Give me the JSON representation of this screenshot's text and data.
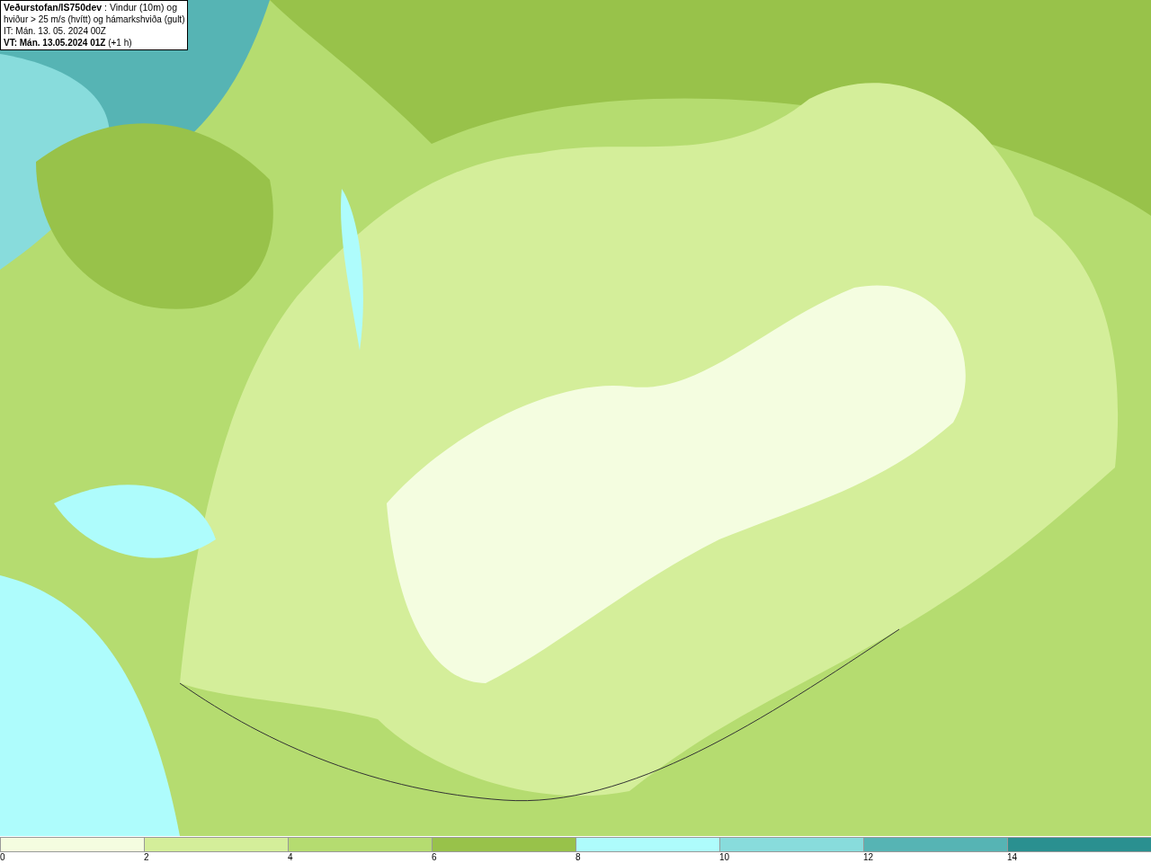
{
  "map": {
    "title_lines": [
      "**Veðurstofan/IS750dev** : Vindur (10m) og",
      "hviður > 25 m/s (hvítt) og hámarkshviða (gult)",
      "IT: Mán. 13. 05. 2024 00Z",
      "**VT: Mán. 13.05.2024 01Z** (+1 h)"
    ]
  },
  "legend": {
    "bins": [
      {
        "color": "#f4fde0"
      },
      {
        "color": "#d4ee9a"
      },
      {
        "color": "#b5dc70"
      },
      {
        "color": "#98c24a"
      },
      {
        "color": "#aefcfc"
      },
      {
        "color": "#88dcdc"
      },
      {
        "color": "#56b4b4"
      },
      {
        "color": "#2a9090"
      }
    ],
    "ticks": [
      "0",
      "2",
      "4",
      "6",
      "8",
      "10",
      "12",
      "14"
    ]
  }
}
